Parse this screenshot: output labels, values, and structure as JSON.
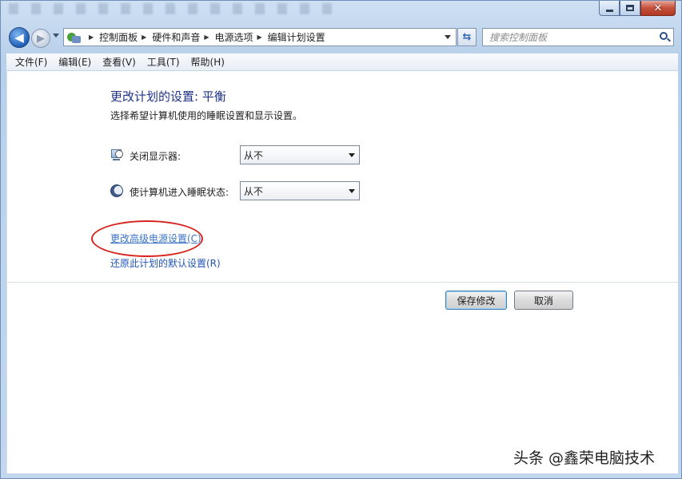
{
  "window": {
    "buttons": {
      "minimize": "minimize",
      "maximize": "maximize",
      "close": "✕"
    }
  },
  "nav": {
    "back_glyph": "◀",
    "forward_glyph": "▶",
    "refresh_glyph": "⇆",
    "breadcrumbs": [
      "控制面板",
      "硬件和声音",
      "电源选项",
      "编辑计划设置"
    ],
    "search_placeholder": "搜索控制面板"
  },
  "menu": {
    "items": [
      "文件(F)",
      "编辑(E)",
      "查看(V)",
      "工具(T)",
      "帮助(H)"
    ]
  },
  "content": {
    "title": "更改计划的设置: 平衡",
    "subtitle": "选择希望计算机使用的睡眠设置和显示设置。",
    "display_off": {
      "label": "关闭显示器:",
      "value": "从不"
    },
    "sleep": {
      "label": "使计算机进入睡眠状态:",
      "value": "从不"
    },
    "links": {
      "advanced": "更改高级电源设置(C)",
      "restore": "还原此计划的默认设置(R)"
    },
    "buttons": {
      "save": "保存修改",
      "cancel": "取消"
    }
  },
  "watermark": "头条 @鑫荣电脑技术",
  "colors": {
    "heading": "#1e3287",
    "link": "#2255b4",
    "highlight": "#d8231c",
    "close": "#c4503b"
  },
  "icons": [
    "back-arrow-icon",
    "forward-arrow-icon",
    "control-panel-icon",
    "refresh-icon",
    "search-icon",
    "monitor-clock-icon",
    "moon-sleep-icon"
  ]
}
